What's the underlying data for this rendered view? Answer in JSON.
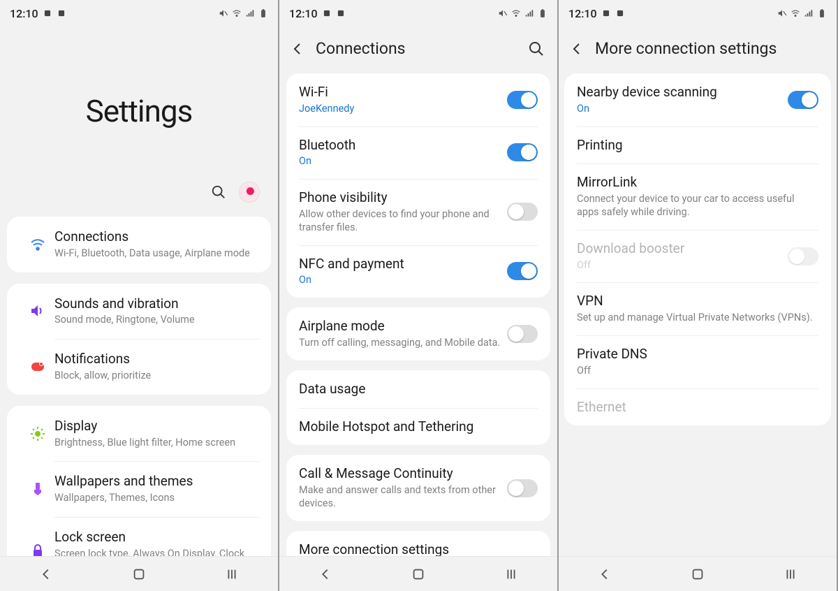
{
  "status": {
    "time": "12:10"
  },
  "screen1": {
    "title": "Settings",
    "groups": [
      [
        {
          "icon": "wifi",
          "color": "#3b82f6",
          "title": "Connections",
          "sub": "Wi-Fi, Bluetooth, Data usage, Airplane mode"
        }
      ],
      [
        {
          "icon": "sound",
          "color": "#7c3aed",
          "title": "Sounds and vibration",
          "sub": "Sound mode, Ringtone, Volume"
        },
        {
          "icon": "notif",
          "color": "#ef4444",
          "title": "Notifications",
          "sub": "Block, allow, prioritize"
        }
      ],
      [
        {
          "icon": "display",
          "color": "#84cc16",
          "title": "Display",
          "sub": "Brightness, Blue light filter, Home screen"
        },
        {
          "icon": "wall",
          "color": "#a855f7",
          "title": "Wallpapers and themes",
          "sub": "Wallpapers, Themes, Icons"
        },
        {
          "icon": "lock",
          "color": "#7c3aed",
          "title": "Lock screen",
          "sub": "Screen lock type, Always On Display, Clock style"
        }
      ]
    ]
  },
  "screen2": {
    "title": "Connections",
    "groups": [
      [
        {
          "title": "Wi-Fi",
          "sub": "JoeKennedy",
          "subBlue": true,
          "toggle": "on"
        },
        {
          "title": "Bluetooth",
          "sub": "On",
          "subBlue": true,
          "toggle": "on"
        },
        {
          "title": "Phone visibility",
          "sub": "Allow other devices to find your phone and transfer files.",
          "toggle": "off"
        },
        {
          "title": "NFC and payment",
          "sub": "On",
          "subBlue": true,
          "toggle": "on"
        }
      ],
      [
        {
          "title": "Airplane mode",
          "sub": "Turn off calling, messaging, and Mobile data.",
          "toggle": "off"
        }
      ],
      [
        {
          "title": "Data usage"
        },
        {
          "title": "Mobile Hotspot and Tethering"
        }
      ],
      [
        {
          "title": "Call & Message Continuity",
          "sub": "Make and answer calls and texts from other devices.",
          "toggle": "off"
        }
      ],
      [
        {
          "title": "More connection settings"
        }
      ]
    ]
  },
  "screen3": {
    "title": "More connection settings",
    "items": [
      {
        "title": "Nearby device scanning",
        "sub": "On",
        "subBlue": true,
        "toggle": "on"
      },
      {
        "title": "Printing"
      },
      {
        "title": "MirrorLink",
        "sub": "Connect your device to your car to access useful apps safely while driving."
      },
      {
        "title": "Download booster",
        "sub": "Off",
        "disabled": true,
        "toggle": "off"
      },
      {
        "title": "VPN",
        "sub": "Set up and manage Virtual Private Networks (VPNs)."
      },
      {
        "title": "Private DNS",
        "sub": "Off"
      },
      {
        "title": "Ethernet",
        "disabled": true
      }
    ]
  }
}
